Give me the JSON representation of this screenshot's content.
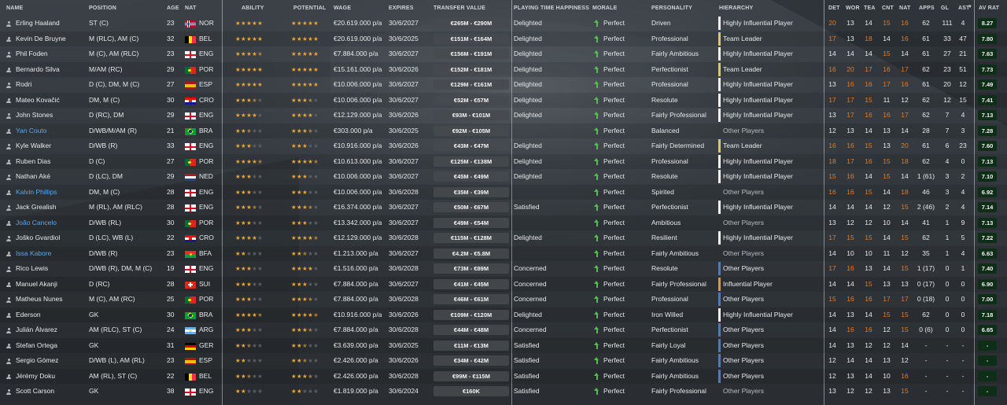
{
  "headers": {
    "name": "NAME",
    "position": "POSITION",
    "age": "AGE",
    "nat": "NAT",
    "ability": "ABILITY",
    "potential": "POTENTIAL",
    "wage": "WAGE",
    "expires": "EXPIRES",
    "transfer_value": "TRANSFER VALUE",
    "playing_time": "PLAYING TIME HAPPINESS",
    "morale": "MORALE",
    "personality": "PERSONALITY",
    "hierarchy": "HIERARCHY",
    "det": "DET",
    "wor": "WOR",
    "tea": "TEA",
    "cnt": "CNT",
    "natr": "NAT",
    "apps": "APPS",
    "gls": "GL",
    "ast": "AST",
    "avrat": "AV RAT"
  },
  "colors": {
    "orange_attr": "#e07b2a",
    "white_attr": "#e8e8e8",
    "star_on": "#e8a33a",
    "star_off": "#5b5f63",
    "hier_white": "#f2f2f2",
    "hier_yellow": "#e6c84a",
    "hier_orange": "#e8952e",
    "hier_blue": "#3f7fd1",
    "morale_green": "#4fc14a"
  },
  "players": [
    {
      "name": "Erling Haaland",
      "position": "ST (C)",
      "age": "23",
      "nat": "NOR",
      "flag": "NOR",
      "ability": 5,
      "potential": 5,
      "wage": "€20.619.000 p/a",
      "expires": "30/6/2027",
      "value": "€265M - €290M",
      "happiness": "Delighted",
      "morale": "Perfect",
      "personality": "Driven",
      "hierarchy": "Highly Influential Player",
      "hbar": "white",
      "det": "20",
      "wor": "13",
      "tea": "14",
      "cnt": "15",
      "natv": "16",
      "apps": "62",
      "gls": "111",
      "ast": "4",
      "avr": "8.27",
      "blue": false
    },
    {
      "name": "Kevin De Bruyne",
      "position": "M (RLC), AM (C)",
      "age": "32",
      "nat": "BEL",
      "flag": "BEL",
      "ability": 5,
      "potential": 5,
      "wage": "€20.619.000 p/a",
      "expires": "30/6/2025",
      "value": "€151M - €164M",
      "happiness": "Delighted",
      "morale": "Perfect",
      "personality": "Professional",
      "hierarchy": "Team Leader",
      "hbar": "yellow",
      "det": "17",
      "wor": "13",
      "tea": "18",
      "cnt": "14",
      "natv": "16",
      "apps": "61",
      "gls": "33",
      "ast": "47",
      "avr": "7.80",
      "blue": false
    },
    {
      "name": "Phil Foden",
      "position": "M (C), AM (RLC)",
      "age": "23",
      "nat": "ENG",
      "flag": "ENG",
      "ability": 4.5,
      "potential": 5,
      "wage": "€7.884.000 p/a",
      "expires": "30/6/2027",
      "value": "€156M - €191M",
      "happiness": "Delighted",
      "morale": "Perfect",
      "personality": "Fairly Ambitious",
      "hierarchy": "Highly Influential Player",
      "hbar": "white",
      "det": "14",
      "wor": "14",
      "tea": "14",
      "cnt": "15",
      "natv": "14",
      "apps": "61",
      "gls": "27",
      "ast": "21",
      "avr": "7.63",
      "blue": false
    },
    {
      "name": "Bernardo Silva",
      "position": "M/AM (RC)",
      "age": "29",
      "nat": "POR",
      "flag": "POR",
      "ability": 5,
      "potential": 5,
      "wage": "€15.161.000 p/a",
      "expires": "30/6/2026",
      "value": "€152M - €181M",
      "happiness": "Delighted",
      "morale": "Perfect",
      "personality": "Perfectionist",
      "hierarchy": "Team Leader",
      "hbar": "yellow",
      "det": "16",
      "wor": "20",
      "tea": "17",
      "cnt": "16",
      "natv": "17",
      "apps": "62",
      "gls": "23",
      "ast": "51",
      "avr": "7.73",
      "blue": false
    },
    {
      "name": "Rodri",
      "position": "D (C), DM, M (C)",
      "age": "27",
      "nat": "ESP",
      "flag": "ESP",
      "ability": 5,
      "potential": 5,
      "wage": "€10.006.000 p/a",
      "expires": "30/6/2027",
      "value": "€129M - €161M",
      "happiness": "Delighted",
      "morale": "Perfect",
      "personality": "Professional",
      "hierarchy": "Highly Influential Player",
      "hbar": "white",
      "det": "13",
      "wor": "16",
      "tea": "16",
      "cnt": "17",
      "natv": "16",
      "apps": "61",
      "gls": "20",
      "ast": "12",
      "avr": "7.49",
      "blue": false
    },
    {
      "name": "Mateo Kovačić",
      "position": "DM, M (C)",
      "age": "30",
      "nat": "CRO",
      "flag": "CRO",
      "ability": 3.5,
      "potential": 3.5,
      "wage": "€10.006.000 p/a",
      "expires": "30/6/2027",
      "value": "€52M - €57M",
      "happiness": "Delighted",
      "morale": "Perfect",
      "personality": "Resolute",
      "hierarchy": "Highly Influential Player",
      "hbar": "white",
      "det": "17",
      "wor": "17",
      "tea": "15",
      "cnt": "11",
      "natv": "12",
      "apps": "62",
      "gls": "12",
      "ast": "15",
      "avr": "7.41",
      "blue": false
    },
    {
      "name": "John Stones",
      "position": "D (RC), DM",
      "age": "29",
      "nat": "ENG",
      "flag": "ENG",
      "ability": 4,
      "potential": 4,
      "wage": "€12.129.000 p/a",
      "expires": "30/6/2026",
      "value": "€93M - €101M",
      "happiness": "Delighted",
      "morale": "Perfect",
      "personality": "Fairly Professional",
      "hierarchy": "Highly Influential Player",
      "hbar": "white",
      "det": "13",
      "wor": "17",
      "tea": "16",
      "cnt": "16",
      "natv": "17",
      "apps": "62",
      "gls": "7",
      "ast": "4",
      "avr": "7.13",
      "blue": false
    },
    {
      "name": "Yan Couto",
      "position": "D/WB/M/AM (R)",
      "age": "21",
      "nat": "BRA",
      "flag": "BRA",
      "ability": 2.5,
      "potential": 3.5,
      "wage": "€303.000 p/a",
      "expires": "30/6/2025",
      "value": "€92M - €105M",
      "happiness": "",
      "morale": "Perfect",
      "personality": "Balanced",
      "hierarchy": "Other Players",
      "hbar": "none",
      "det": "12",
      "wor": "13",
      "tea": "14",
      "cnt": "13",
      "natv": "14",
      "apps": "28",
      "gls": "7",
      "ast": "3",
      "avr": "7.28",
      "blue": true
    },
    {
      "name": "Kyle Walker",
      "position": "D/WB (R)",
      "age": "33",
      "nat": "ENG",
      "flag": "ENG",
      "ability": 3,
      "potential": 3,
      "wage": "€10.916.000 p/a",
      "expires": "30/6/2026",
      "value": "€43M - €47M",
      "happiness": "Delighted",
      "morale": "Perfect",
      "personality": "Fairly Determined",
      "hierarchy": "Team Leader",
      "hbar": "yellow",
      "det": "16",
      "wor": "16",
      "tea": "15",
      "cnt": "13",
      "natv": "20",
      "apps": "61",
      "gls": "6",
      "ast": "23",
      "avr": "7.60",
      "blue": false
    },
    {
      "name": "Ruben Dias",
      "position": "D (C)",
      "age": "27",
      "nat": "POR",
      "flag": "POR",
      "ability": 4.5,
      "potential": 4.5,
      "wage": "€10.613.000 p/a",
      "expires": "30/6/2027",
      "value": "€125M - €138M",
      "happiness": "Delighted",
      "morale": "Perfect",
      "personality": "Professional",
      "hierarchy": "Highly Influential Player",
      "hbar": "white",
      "det": "18",
      "wor": "17",
      "tea": "16",
      "cnt": "15",
      "natv": "18",
      "apps": "62",
      "gls": "4",
      "ast": "0",
      "avr": "7.13",
      "blue": false
    },
    {
      "name": "Nathan Aké",
      "position": "D (LC), DM",
      "age": "29",
      "nat": "NED",
      "flag": "NED",
      "ability": 3,
      "potential": 3,
      "wage": "€10.006.000 p/a",
      "expires": "30/6/2027",
      "value": "€45M - €49M",
      "happiness": "Delighted",
      "morale": "Perfect",
      "personality": "Resolute",
      "hierarchy": "Highly Influential Player",
      "hbar": "white",
      "det": "15",
      "wor": "16",
      "tea": "14",
      "cnt": "15",
      "natv": "14",
      "apps": "1 (61)",
      "gls": "3",
      "ast": "2",
      "avr": "7.10",
      "blue": false
    },
    {
      "name": "Kalvin Phillips",
      "position": "DM, M (C)",
      "age": "28",
      "nat": "ENG",
      "flag": "ENG",
      "ability": 3,
      "potential": 3,
      "wage": "€10.006.000 p/a",
      "expires": "30/6/2028",
      "value": "€35M - €39M",
      "happiness": "",
      "morale": "Perfect",
      "personality": "Spirited",
      "hierarchy": "Other Players",
      "hbar": "none",
      "det": "16",
      "wor": "16",
      "tea": "15",
      "cnt": "14",
      "natv": "18",
      "apps": "46",
      "gls": "3",
      "ast": "4",
      "avr": "6.92",
      "blue": true
    },
    {
      "name": "Jack Grealish",
      "position": "M (RL), AM (RLC)",
      "age": "28",
      "nat": "ENG",
      "flag": "ENG",
      "ability": 3.5,
      "potential": 3.5,
      "wage": "€16.374.000 p/a",
      "expires": "30/6/2027",
      "value": "€50M - €67M",
      "happiness": "Satisfied",
      "morale": "Perfect",
      "personality": "Perfectionist",
      "hierarchy": "Highly Influential Player",
      "hbar": "white",
      "det": "14",
      "wor": "14",
      "tea": "14",
      "cnt": "12",
      "natv": "15",
      "apps": "2 (46)",
      "gls": "2",
      "ast": "4",
      "avr": "7.14",
      "blue": false
    },
    {
      "name": "João Cancelo",
      "position": "D/WB (RL)",
      "age": "30",
      "nat": "POR",
      "flag": "POR",
      "ability": 3,
      "potential": 3,
      "wage": "€13.342.000 p/a",
      "expires": "30/6/2027",
      "value": "€49M - €54M",
      "happiness": "",
      "morale": "Perfect",
      "personality": "Ambitious",
      "hierarchy": "Other Players",
      "hbar": "none",
      "det": "13",
      "wor": "12",
      "tea": "12",
      "cnt": "10",
      "natv": "14",
      "apps": "41",
      "gls": "1",
      "ast": "9",
      "avr": "7.13",
      "blue": true
    },
    {
      "name": "Joško Gvardiol",
      "position": "D (LC), WB (L)",
      "age": "22",
      "nat": "CRO",
      "flag": "CRO",
      "ability": 4,
      "potential": 4.5,
      "wage": "€12.129.000 p/a",
      "expires": "30/6/2028",
      "value": "€115M - €128M",
      "happiness": "Delighted",
      "morale": "Perfect",
      "personality": "Resilient",
      "hierarchy": "Highly Influential Player",
      "hbar": "white",
      "det": "17",
      "wor": "15",
      "tea": "15",
      "cnt": "14",
      "natv": "15",
      "apps": "62",
      "gls": "1",
      "ast": "5",
      "avr": "7.22",
      "blue": false
    },
    {
      "name": "Issa Kabore",
      "position": "D/WB (R)",
      "age": "23",
      "nat": "BFA",
      "flag": "BFA",
      "ability": 2,
      "potential": 2.5,
      "wage": "€1.213.000 p/a",
      "expires": "30/6/2027",
      "value": "€4.2M - €5.8M",
      "happiness": "",
      "morale": "Perfect",
      "personality": "Fairly Ambitious",
      "hierarchy": "Other Players",
      "hbar": "none",
      "det": "14",
      "wor": "10",
      "tea": "10",
      "cnt": "11",
      "natv": "12",
      "apps": "35",
      "gls": "1",
      "ast": "4",
      "avr": "6.63",
      "blue": true
    },
    {
      "name": "Rico Lewis",
      "position": "D/WB (R), DM, M (C)",
      "age": "19",
      "nat": "ENG",
      "flag": "ENG",
      "ability": 3,
      "potential": 4,
      "wage": "€1.516.000 p/a",
      "expires": "30/6/2028",
      "value": "€73M - €89M",
      "happiness": "Concerned",
      "morale": "Perfect",
      "personality": "Resolute",
      "hierarchy": "Other Players",
      "hbar": "blue",
      "det": "17",
      "wor": "16",
      "tea": "13",
      "cnt": "14",
      "natv": "15",
      "apps": "1 (17)",
      "gls": "0",
      "ast": "1",
      "avr": "7.40",
      "blue": false
    },
    {
      "name": "Manuel Akanji",
      "position": "D (RC)",
      "age": "28",
      "nat": "SUI",
      "flag": "SUI",
      "ability": 3,
      "potential": 3,
      "wage": "€7.884.000 p/a",
      "expires": "30/6/2027",
      "value": "€41M - €45M",
      "happiness": "Concerned",
      "morale": "Perfect",
      "personality": "Fairly Professional",
      "hierarchy": "Influential Player",
      "hbar": "orange",
      "det": "14",
      "wor": "14",
      "tea": "15",
      "cnt": "13",
      "natv": "13",
      "apps": "0 (17)",
      "gls": "0",
      "ast": "0",
      "avr": "6.90",
      "blue": false
    },
    {
      "name": "Matheus Nunes",
      "position": "M (C), AM (RC)",
      "age": "25",
      "nat": "POR",
      "flag": "POR",
      "ability": 3,
      "potential": 3.5,
      "wage": "€7.884.000 p/a",
      "expires": "30/6/2028",
      "value": "€46M - €61M",
      "happiness": "Concerned",
      "morale": "Perfect",
      "personality": "Professional",
      "hierarchy": "Other Players",
      "hbar": "blue",
      "det": "15",
      "wor": "16",
      "tea": "16",
      "cnt": "17",
      "natv": "17",
      "apps": "0 (18)",
      "gls": "0",
      "ast": "0",
      "avr": "7.00",
      "blue": false
    },
    {
      "name": "Ederson",
      "position": "GK",
      "age": "30",
      "nat": "BRA",
      "flag": "BRA",
      "ability": 4.5,
      "potential": 4.5,
      "wage": "€10.916.000 p/a",
      "expires": "30/6/2026",
      "value": "€109M - €120M",
      "happiness": "Delighted",
      "morale": "Perfect",
      "personality": "Iron Willed",
      "hierarchy": "Highly Influential Player",
      "hbar": "white",
      "det": "14",
      "wor": "13",
      "tea": "14",
      "cnt": "15",
      "natv": "15",
      "apps": "62",
      "gls": "0",
      "ast": "0",
      "avr": "7.18",
      "blue": false
    },
    {
      "name": "Julián Álvarez",
      "position": "AM (RLC), ST (C)",
      "age": "24",
      "nat": "ARG",
      "flag": "ARG",
      "ability": 3,
      "potential": 3.5,
      "wage": "€7.884.000 p/a",
      "expires": "30/6/2028",
      "value": "€44M - €48M",
      "happiness": "Concerned",
      "morale": "Perfect",
      "personality": "Perfectionist",
      "hierarchy": "Other Players",
      "hbar": "blue",
      "det": "14",
      "wor": "16",
      "tea": "16",
      "cnt": "12",
      "natv": "15",
      "apps": "0 (6)",
      "gls": "0",
      "ast": "0",
      "avr": "6.65",
      "blue": false
    },
    {
      "name": "Stefan Ortega",
      "position": "GK",
      "age": "31",
      "nat": "GER",
      "flag": "GER",
      "ability": 2.5,
      "potential": 2.5,
      "wage": "€3.639.000 p/a",
      "expires": "30/6/2025",
      "value": "€11M - €13M",
      "happiness": "Satisfied",
      "morale": "Perfect",
      "personality": "Fairly Loyal",
      "hierarchy": "Other Players",
      "hbar": "blue",
      "det": "14",
      "wor": "13",
      "tea": "12",
      "cnt": "12",
      "natv": "14",
      "apps": "-",
      "gls": "-",
      "ast": "-",
      "avr": "-",
      "blue": false
    },
    {
      "name": "Sergio Gómez",
      "position": "D/WB (L), AM (RL)",
      "age": "23",
      "nat": "ESP",
      "flag": "ESP",
      "ability": 2,
      "potential": 2.5,
      "wage": "€2.426.000 p/a",
      "expires": "30/6/2026",
      "value": "€34M - €42M",
      "happiness": "Satisfied",
      "morale": "Perfect",
      "personality": "Fairly Ambitious",
      "hierarchy": "Other Players",
      "hbar": "blue",
      "det": "12",
      "wor": "14",
      "tea": "14",
      "cnt": "13",
      "natv": "12",
      "apps": "-",
      "gls": "-",
      "ast": "-",
      "avr": "-",
      "blue": false
    },
    {
      "name": "Jérémy Doku",
      "position": "AM (RL), ST (C)",
      "age": "22",
      "nat": "BEL",
      "flag": "BEL",
      "ability": 2.5,
      "potential": 3.5,
      "wage": "€2.426.000 p/a",
      "expires": "30/6/2028",
      "value": "€99M - €115M",
      "happiness": "Satisfied",
      "morale": "Perfect",
      "personality": "Fairly Ambitious",
      "hierarchy": "Other Players",
      "hbar": "blue",
      "det": "12",
      "wor": "13",
      "tea": "14",
      "cnt": "10",
      "natv": "16",
      "apps": "-",
      "gls": "-",
      "ast": "-",
      "avr": "-",
      "blue": false
    },
    {
      "name": "Scott Carson",
      "position": "GK",
      "age": "38",
      "nat": "ENG",
      "flag": "ENG",
      "ability": 2,
      "potential": 2,
      "wage": "€1.819.000 p/a",
      "expires": "30/6/2024",
      "value": "€160K",
      "happiness": "Satisfied",
      "morale": "Perfect",
      "personality": "Fairly Professional",
      "hierarchy": "Other Players",
      "hbar": "none",
      "det": "13",
      "wor": "12",
      "tea": "12",
      "cnt": "13",
      "natv": "15",
      "apps": "-",
      "gls": "-",
      "ast": "-",
      "avr": "-",
      "blue": false
    }
  ]
}
